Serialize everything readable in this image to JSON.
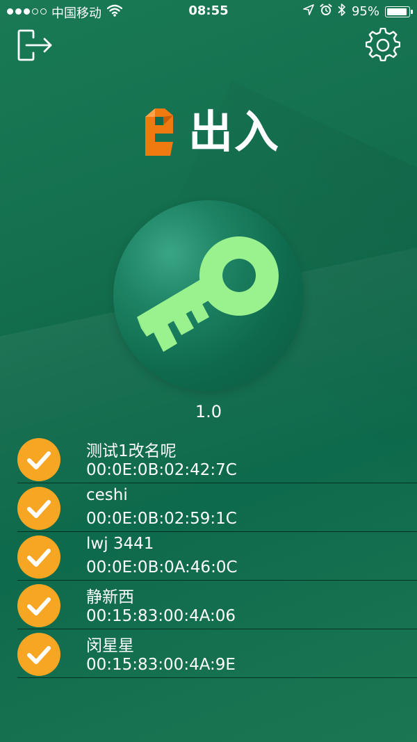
{
  "status_bar": {
    "carrier": "中国移动",
    "time": "08:55",
    "battery": "95%",
    "battery_level": 0.95,
    "signal_bars": 3,
    "signal_total": 5
  },
  "header": {
    "logout_icon": "logout-icon",
    "settings_icon": "gear-icon"
  },
  "logo": {
    "mark_icon": "e-logo-icon",
    "text": "出入",
    "mark_color": "#f07a10"
  },
  "main": {
    "key_icon": "key-icon",
    "key_color": "#9af28e",
    "version": "1.0"
  },
  "devices": [
    {
      "name": "测试1改名呢",
      "mac": "00:0E:0B:02:42:7C"
    },
    {
      "name": "ceshi",
      "mac": "00:0E:0B:02:59:1C"
    },
    {
      "name": "lwj 3441",
      "mac": "00:0E:0B:0A:46:0C"
    },
    {
      "name": "静新西",
      "mac": "00:15:83:00:4A:06"
    },
    {
      "name": "闵星星",
      "mac": "00:15:83:00:4A:9E"
    }
  ],
  "colors": {
    "background": "#116a4b",
    "check_badge": "#f6a623",
    "divider": "#0b3a28"
  }
}
